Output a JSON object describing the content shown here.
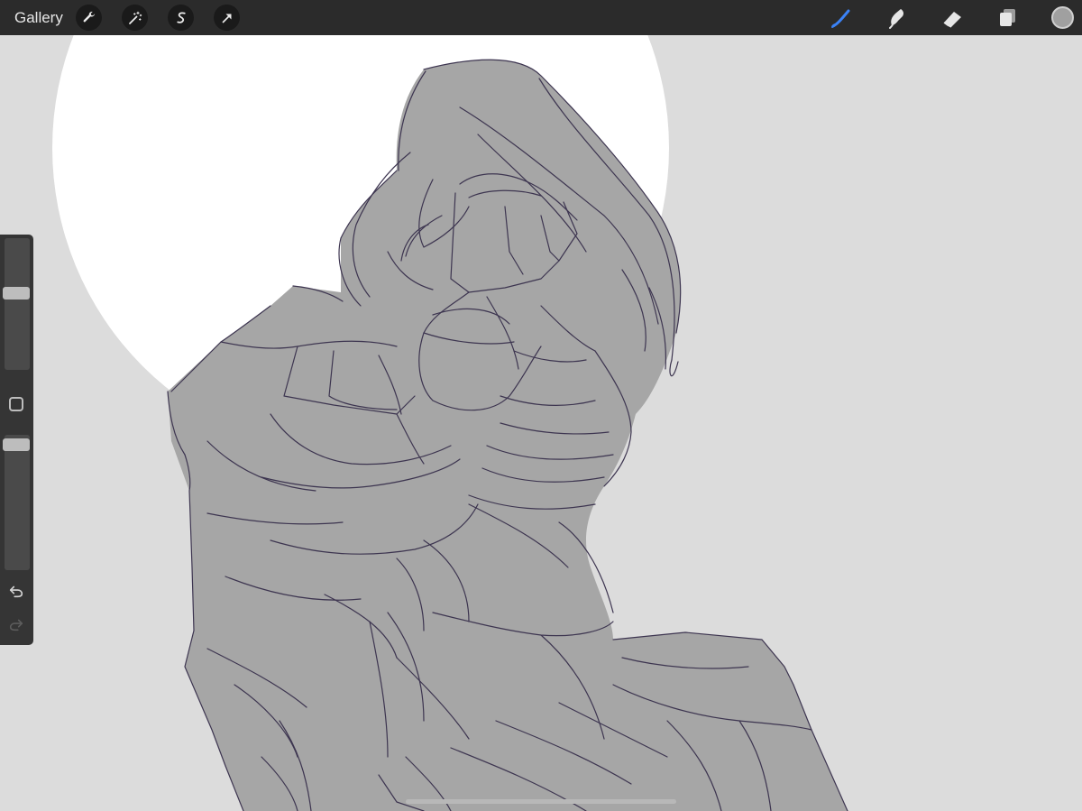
{
  "topbar": {
    "gallery_label": "Gallery",
    "left_tools": [
      {
        "icon": "wrench-icon"
      },
      {
        "icon": "magic-wand-icon"
      },
      {
        "icon": "selection-icon"
      },
      {
        "icon": "transform-arrow-icon"
      }
    ],
    "right_tools": [
      {
        "icon": "brush-icon",
        "active": true,
        "color": "#3b82f6"
      },
      {
        "icon": "smudge-icon"
      },
      {
        "icon": "eraser-icon"
      },
      {
        "icon": "layers-icon"
      }
    ],
    "current_color": "#a0a0a0"
  },
  "sidebar": {
    "brush_size_level": 0.63,
    "opacity_level": 0.95,
    "icons": [
      "modify-square-icon",
      "undo-icon",
      "redo-icon"
    ]
  },
  "canvas": {
    "background_color": "#dcdcdc",
    "circle_color": "#ffffff",
    "fill_color": "#a6a6a6",
    "line_color": "#3d3550"
  }
}
